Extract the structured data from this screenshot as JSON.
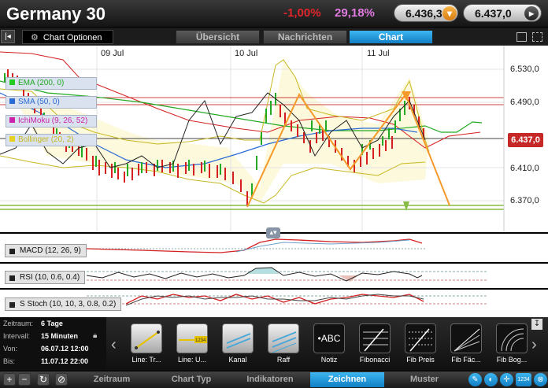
{
  "header": {
    "title": "Germany 30",
    "change_pct": "-1,00%",
    "second_pct": "29,18%",
    "bid": "6.436,3",
    "ask": "6.437,0"
  },
  "toolbar": {
    "chart_options_label": "Chart Optionen",
    "tabs": [
      {
        "label": "Übersicht",
        "active": false
      },
      {
        "label": "Nachrichten",
        "active": false
      },
      {
        "label": "Chart",
        "active": true
      }
    ]
  },
  "chart": {
    "date_labels": [
      "09 Jul",
      "10 Jul",
      "11 Jul"
    ],
    "price_labels": [
      "6.530,0",
      "6.490,0",
      "6.410,0",
      "6.370,0"
    ],
    "current_price_tag": "6.437,0",
    "legend": [
      {
        "label": "EMA (200, 0)",
        "color": "#22cc22"
      },
      {
        "label": "SMA (50, 0)",
        "color": "#2a6ad6"
      },
      {
        "label": "IchiMoku (9, 26, 52)",
        "color": "#cc22aa"
      },
      {
        "label": "Bollinger (20, 2)",
        "color": "#e6d020"
      }
    ],
    "indicators": [
      {
        "label": "MACD (12, 26, 9)"
      },
      {
        "label": "RSI (10, 0.6, 0.4)"
      },
      {
        "label": "S Stoch (10, 10, 3, 0.8, 0.2)"
      }
    ]
  },
  "info": {
    "zeitraum_label": "Zeitraum:",
    "zeitraum_value": "6 Tage",
    "intervall_label": "Intervall:",
    "intervall_value": "15 Minuten",
    "von_label": "Von:",
    "von_value": "06.07.12 12:00",
    "bis_label": "Bis:",
    "bis_value": "11.07.12 22:00"
  },
  "tools": [
    {
      "label": "Line: Tr..."
    },
    {
      "label": "Line: U..."
    },
    {
      "label": "Kanal"
    },
    {
      "label": "Raff"
    },
    {
      "label": "Notiz",
      "glyph": "ABC"
    },
    {
      "label": "Fibonacci"
    },
    {
      "label": "Fib Preis"
    },
    {
      "label": "Fib Fäc..."
    },
    {
      "label": "Fib Bog..."
    }
  ],
  "bottom_tabs": [
    {
      "label": "Zeitraum",
      "active": false
    },
    {
      "label": "Chart Typ",
      "active": false
    },
    {
      "label": "Indikatoren",
      "active": false
    },
    {
      "label": "Zeichnen",
      "active": true
    },
    {
      "label": "Muster",
      "active": false
    }
  ],
  "tool_badge": "1234"
}
